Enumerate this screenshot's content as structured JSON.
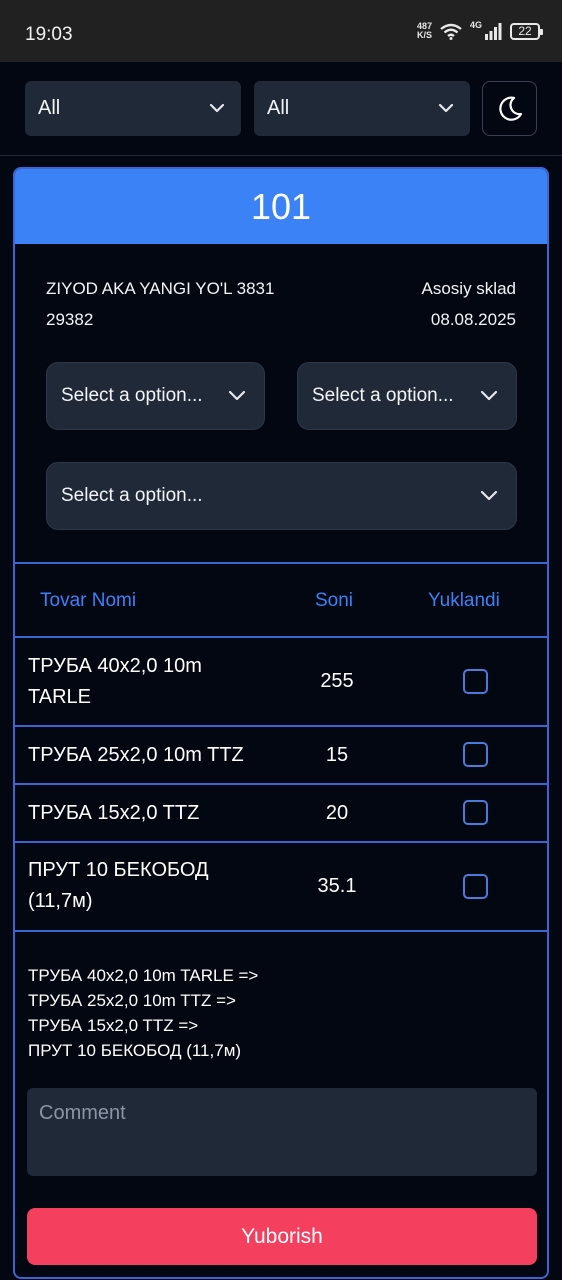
{
  "status_bar": {
    "time": "19:03",
    "net_speed_value": "487",
    "net_speed_unit": "K/S",
    "network": "4G",
    "battery": "22"
  },
  "top": {
    "filter1": "All",
    "filter2": "All",
    "theme_icon": "moon-icon"
  },
  "card": {
    "number": "101",
    "client": "ZIYOD AKA YANGI YO'L 3831",
    "order_id": "29382",
    "warehouse": "Asosiy sklad",
    "date": "08.08.2025",
    "selects": [
      "Select a option...",
      "Select a option...",
      "Select a option..."
    ]
  },
  "table": {
    "headers": {
      "name": "Tovar Nomi",
      "qty": "Soni",
      "loaded": "Yuklandi"
    },
    "rows": [
      {
        "name": "ТРУБА 40x2,0 10m TARLE",
        "qty": "255",
        "loaded": false
      },
      {
        "name": "ТРУБА 25x2,0 10m TTZ",
        "qty": "15",
        "loaded": false
      },
      {
        "name": "ТРУБА 15x2,0 TTZ",
        "qty": "20",
        "loaded": false
      },
      {
        "name": "ПРУТ 10 БЕКОБОД (11,7м)",
        "qty": "35.1",
        "loaded": false
      }
    ]
  },
  "summary": [
    "ТРУБА 40x2,0 10m TARLE =>",
    "ТРУБА 25x2,0 10m TTZ =>",
    "ТРУБА 15x2,0 TTZ =>",
    "ПРУТ 10 БЕКОБОД (11,7м)"
  ],
  "comment": {
    "placeholder": "Comment",
    "value": ""
  },
  "submit_label": "Yuborish",
  "colors": {
    "accent": "#3b82f6",
    "border": "#3b66d1",
    "submit": "#f43f5e",
    "background": "#030712",
    "field": "#1f2937"
  }
}
